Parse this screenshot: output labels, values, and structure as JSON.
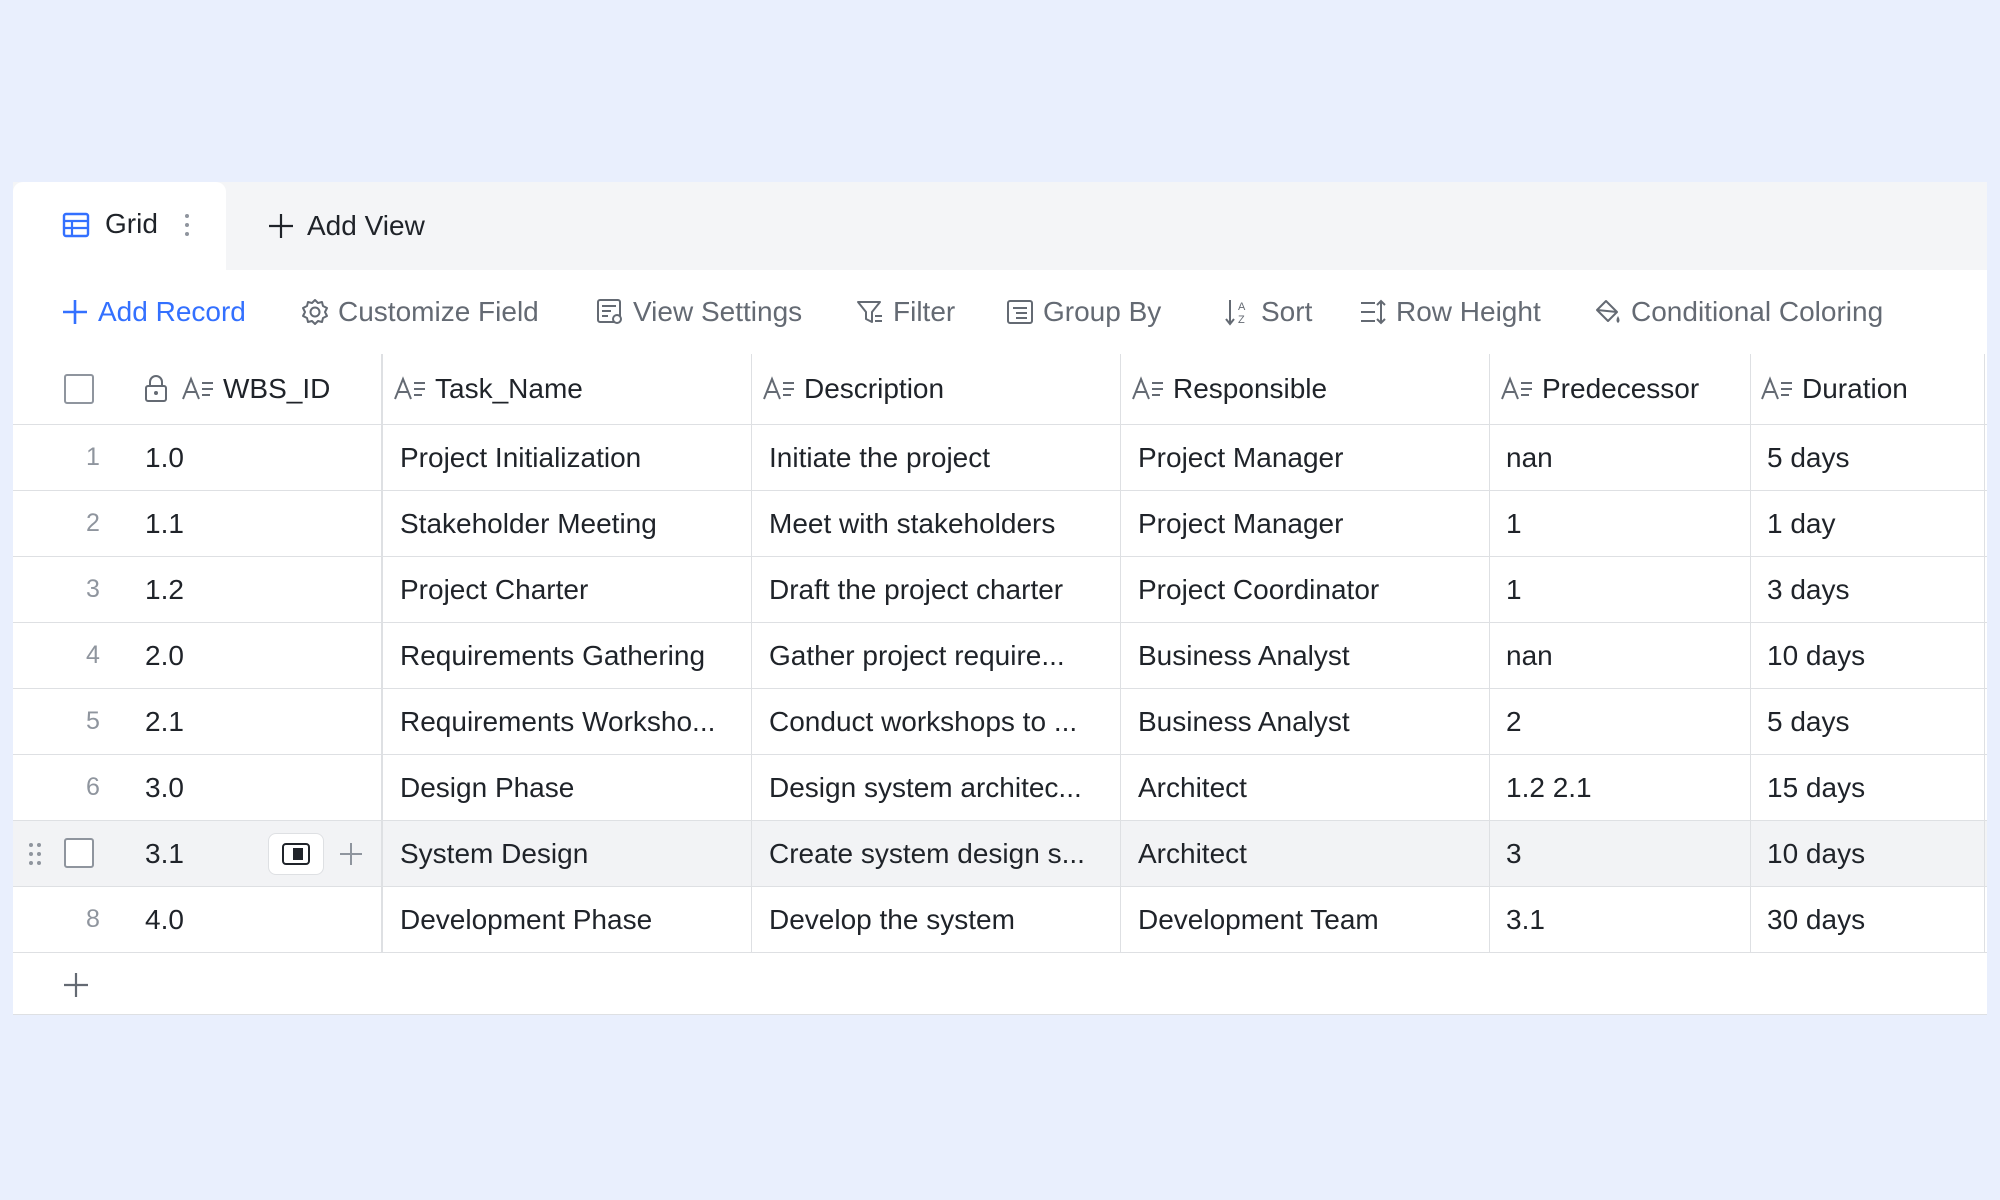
{
  "tabs": {
    "active_label": "Grid",
    "add_view_label": "Add View"
  },
  "toolbar": {
    "add_record": "Add Record",
    "customize_field": "Customize Field",
    "view_settings": "View Settings",
    "filter": "Filter",
    "group_by": "Group By",
    "sort": "Sort",
    "row_height": "Row Height",
    "conditional_coloring": "Conditional Coloring"
  },
  "columns": {
    "wbs_id": "WBS_ID",
    "task_name": "Task_Name",
    "description": "Description",
    "responsible": "Responsible",
    "predecessor": "Predecessor",
    "duration": "Duration"
  },
  "rows": [
    {
      "num": "1",
      "wbs_id": "1.0",
      "task_name": "Project Initialization",
      "description": "Initiate the project",
      "responsible": "Project Manager",
      "predecessor": "nan",
      "duration": "5 days"
    },
    {
      "num": "2",
      "wbs_id": "1.1",
      "task_name": "Stakeholder Meeting",
      "description": "Meet with stakeholders",
      "responsible": "Project Manager",
      "predecessor": "1",
      "duration": "1 day"
    },
    {
      "num": "3",
      "wbs_id": "1.2",
      "task_name": "Project Charter",
      "description": "Draft the project charter",
      "responsible": "Project Coordinator",
      "predecessor": "1",
      "duration": "3 days"
    },
    {
      "num": "4",
      "wbs_id": "2.0",
      "task_name": "Requirements Gathering",
      "description": "Gather project require...",
      "responsible": "Business Analyst",
      "predecessor": "nan",
      "duration": "10 days"
    },
    {
      "num": "5",
      "wbs_id": "2.1",
      "task_name": "Requirements Worksho...",
      "description": "Conduct workshops to ...",
      "responsible": "Business Analyst",
      "predecessor": "2",
      "duration": "5 days"
    },
    {
      "num": "6",
      "wbs_id": "3.0",
      "task_name": "Design Phase",
      "description": "Design system architec...",
      "responsible": "Architect",
      "predecessor": "1.2 2.1",
      "duration": "15 days"
    },
    {
      "num": "7",
      "wbs_id": "3.1",
      "task_name": "System Design",
      "description": "Create system design s...",
      "responsible": "Architect",
      "predecessor": "3",
      "duration": "10 days"
    },
    {
      "num": "8",
      "wbs_id": "4.0",
      "task_name": "Development Phase",
      "description": "Develop the system",
      "responsible": "Development Team",
      "predecessor": "3.1",
      "duration": "30 days"
    }
  ],
  "colors": {
    "accent": "#3370ff",
    "background": "#e9effd",
    "border": "#dee0e3",
    "muted_text": "#646a73",
    "hover_row": "#f2f3f5"
  },
  "icons": {
    "grid_tab": "grid-table-icon",
    "tab_more": "vertical-dots-icon",
    "add_view": "plus-icon",
    "customize_field": "gear-icon",
    "view_settings": "view-settings-icon",
    "filter": "filter-icon",
    "group_by": "group-by-icon",
    "sort": "sort-az-icon",
    "row_height": "row-height-icon",
    "conditional_coloring": "paint-bucket-icon",
    "field_type": "text-field-icon",
    "primary_lock": "lock-icon"
  }
}
